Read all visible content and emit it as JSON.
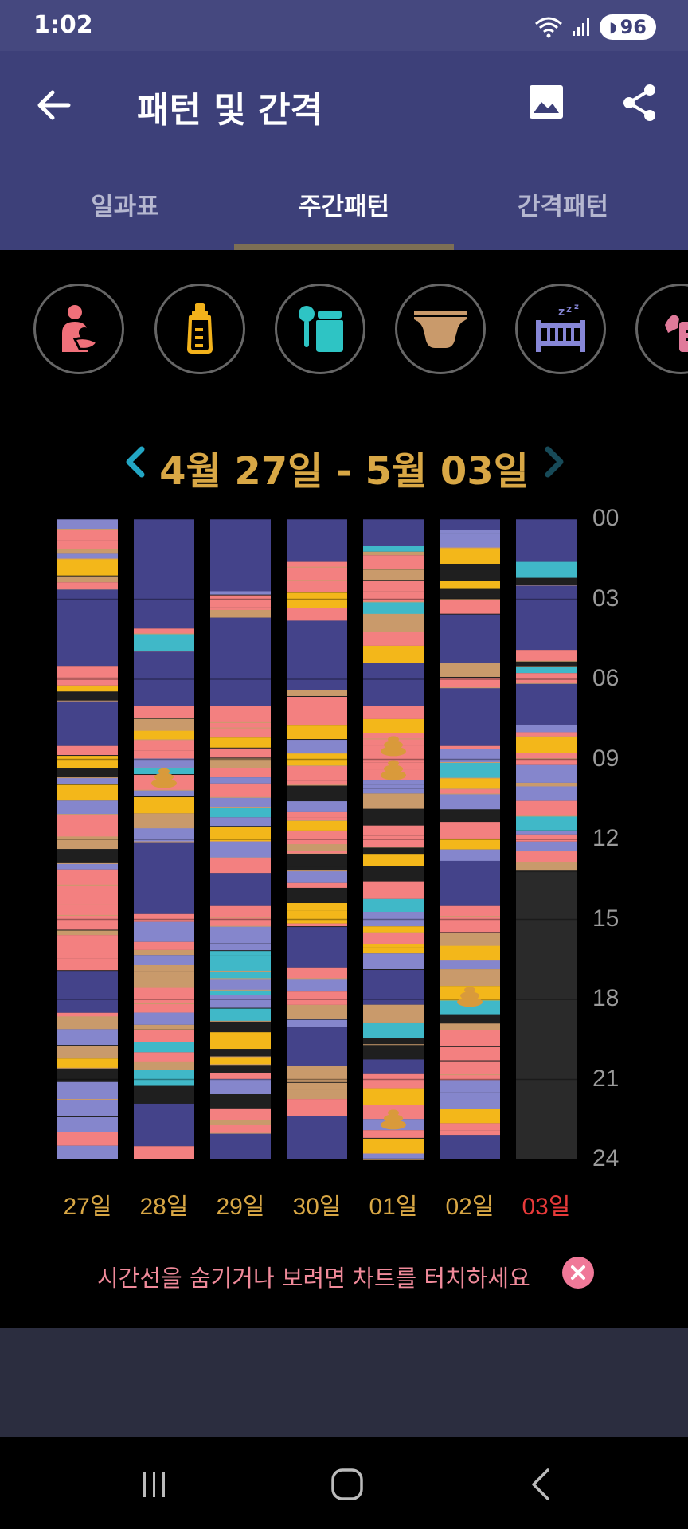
{
  "status": {
    "time": "1:02",
    "battery": "96"
  },
  "header": {
    "title": "패턴 및 간격"
  },
  "tabs": [
    {
      "label": "일과표"
    },
    {
      "label": "주간패턴"
    },
    {
      "label": "간격패턴"
    }
  ],
  "categories": [
    {
      "icon": "breastfeeding-icon",
      "color": "#f0707a"
    },
    {
      "icon": "bottle-icon",
      "color": "#f3b21b"
    },
    {
      "icon": "baby-food-icon",
      "color": "#2ec4c4"
    },
    {
      "icon": "diaper-icon",
      "color": "#c99a6b"
    },
    {
      "icon": "crib-sleep-icon",
      "color": "#8686d6"
    },
    {
      "icon": "pump-icon",
      "color": "#e07a9a"
    }
  ],
  "week": {
    "range": "4월 27일 - 5월 03일"
  },
  "chart_data": {
    "type": "timeline",
    "hour_ticks": [
      "00",
      "03",
      "06",
      "09",
      "12",
      "15",
      "18",
      "21",
      "24"
    ],
    "days": [
      "27일",
      "28일",
      "29일",
      "30일",
      "01일",
      "02일",
      "03일"
    ],
    "today_index": 6,
    "data_end_hour_today": 13.2,
    "colors": {
      "sleep": "#44438a",
      "sleep_light": "#8586cc",
      "feed": "#f38080",
      "diaper": "#c99a6b",
      "bottle": "#f3b71a",
      "gap": "#1f1f1f",
      "empty": "#2a2a2a",
      "cyan": "#40b8c8"
    }
  },
  "hint": {
    "text": "시간선을 숨기거나 보려면 차트를 터치하세요"
  }
}
